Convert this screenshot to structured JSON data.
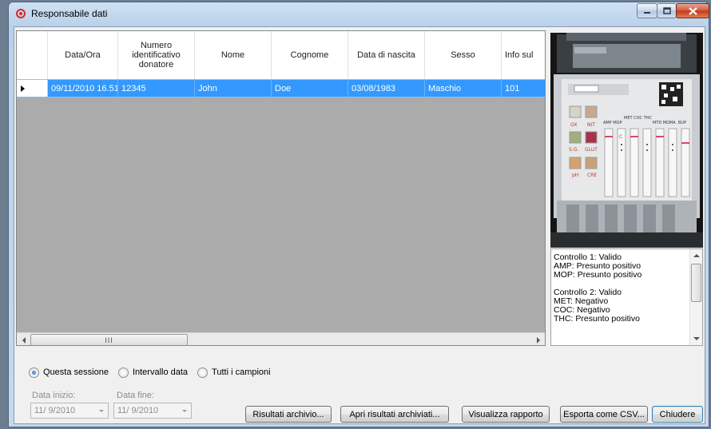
{
  "window": {
    "title": "Responsabile dati",
    "minimize_icon": "minimize-icon",
    "maximize_icon": "maximize-icon",
    "close_icon": "close-icon"
  },
  "grid": {
    "columns": [
      {
        "label": "Data/Ora",
        "w": 0
      },
      {
        "label": "Numero identificativo donatore"
      },
      {
        "label": "Nome"
      },
      {
        "label": "Cognome"
      },
      {
        "label": "Data di nascita"
      },
      {
        "label": "Sesso"
      },
      {
        "label": "Info sul"
      }
    ],
    "rows": [
      {
        "selected": true,
        "cells": [
          "09/11/2010 16.51",
          "12345",
          "John",
          "Doe",
          "03/08/1983",
          "Maschio",
          "101"
        ]
      }
    ],
    "hscroll_grip": "III"
  },
  "results": {
    "lines": [
      "Controllo 1: Valido",
      "AMP: Presunto positivo",
      "MOP: Presunto positivo",
      "",
      "Controllo 2: Valido",
      "MET: Negativo",
      "COC: Negativo",
      "THC: Presunto positivo"
    ]
  },
  "photo": {
    "labels": {
      "ox": "OX",
      "nit": "NIT",
      "sg": "S.G.",
      "glut": "GLUT",
      "ph": "pH",
      "cre": "CRE",
      "amp_mop": "AMP MOP",
      "met_coc_thc": "MET COC THC",
      "mtd_mdma": "MTD MDMA",
      "bup": "BUP",
      "c": "C"
    }
  },
  "filters": {
    "options": [
      {
        "label": "Questa sessione",
        "checked": true
      },
      {
        "label": "Intervallo data",
        "checked": false
      },
      {
        "label": "Tutti i campioni",
        "checked": false
      }
    ],
    "start_label": "Data inizio:",
    "end_label": "Data fine:",
    "start_value": "11/ 9/2010",
    "end_value": "11/ 9/2010"
  },
  "buttons": {
    "archive": "Risultati archivio...",
    "open_archived": "Apri risultati archiviati...",
    "view_report": "Visualizza rapporto",
    "export_csv": "Esporta come CSV...",
    "close": "Chiudere"
  }
}
